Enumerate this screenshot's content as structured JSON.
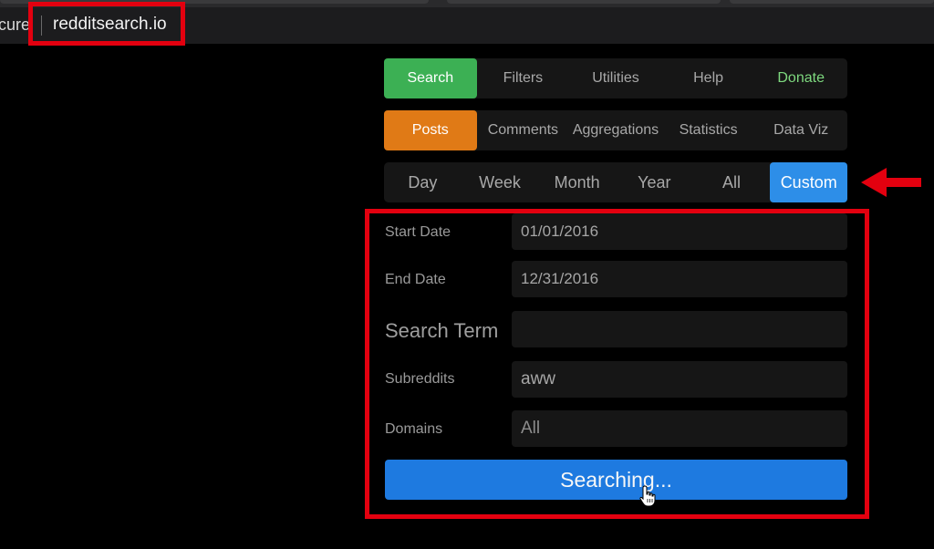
{
  "browser": {
    "secure_text": "cure",
    "url": "redditsearch.io"
  },
  "nav_tabs": [
    {
      "label": "Search",
      "active": true
    },
    {
      "label": "Filters"
    },
    {
      "label": "Utilities"
    },
    {
      "label": "Help"
    },
    {
      "label": "Donate"
    }
  ],
  "type_tabs": [
    {
      "label": "Posts",
      "active": true
    },
    {
      "label": "Comments"
    },
    {
      "label": "Aggregations"
    },
    {
      "label": "Statistics"
    },
    {
      "label": "Data Viz"
    }
  ],
  "range_tabs": [
    {
      "label": "Day"
    },
    {
      "label": "Week"
    },
    {
      "label": "Month"
    },
    {
      "label": "Year"
    },
    {
      "label": "All"
    },
    {
      "label": "Custom",
      "active": true
    }
  ],
  "form": {
    "start_date": {
      "label": "Start Date",
      "value": "01/01/2016"
    },
    "end_date": {
      "label": "End Date",
      "value": "12/31/2016"
    },
    "search_term": {
      "label": "Search Term",
      "value": ""
    },
    "subreddits": {
      "label": "Subreddits",
      "value": "aww"
    },
    "domains": {
      "label": "Domains",
      "placeholder": "All"
    },
    "submit_label": "Searching..."
  },
  "colors": {
    "search_active": "#3cb054",
    "posts_active": "#e07a16",
    "custom_active": "#2d8ee8",
    "donate_text": "#7ed97f",
    "submit_button": "#1e7ae0",
    "annotation_red": "#e3000f"
  },
  "icons": {
    "annotation_arrow": "arrow-left-icon",
    "pointer": "hand-pointer-icon"
  }
}
